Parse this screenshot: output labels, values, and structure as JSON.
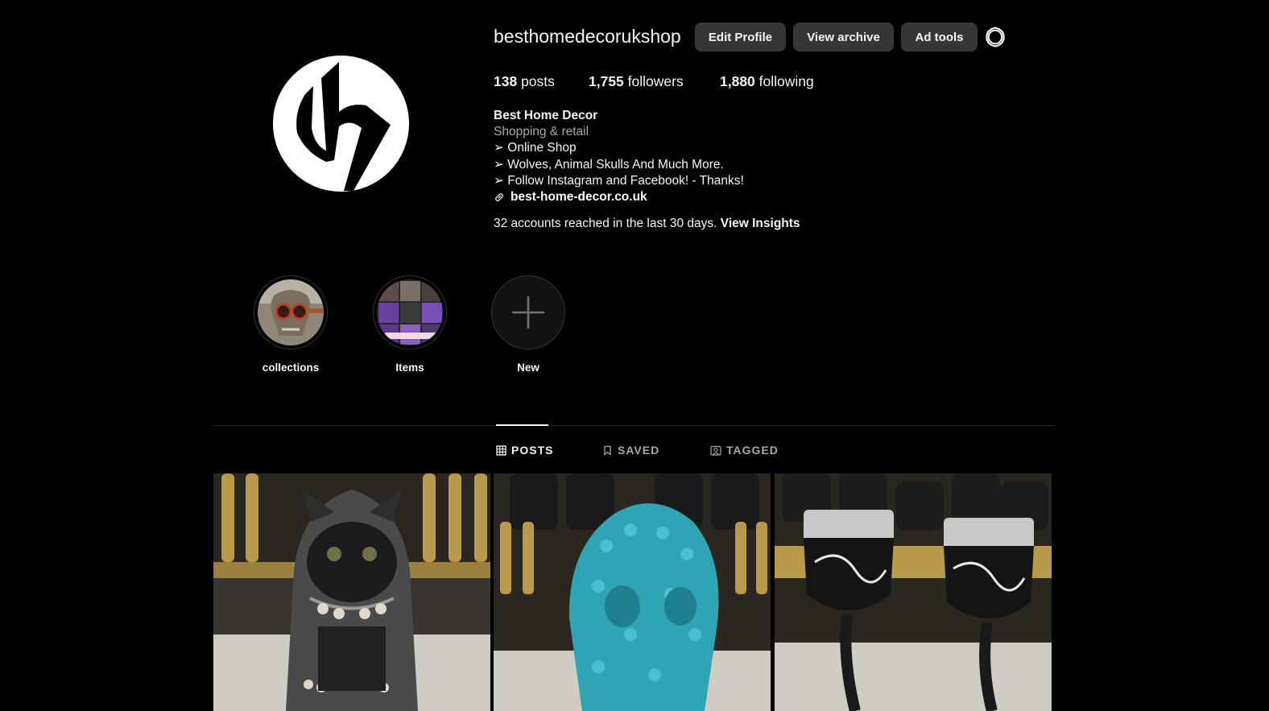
{
  "profile": {
    "username": "besthomedecorukshop",
    "buttons": {
      "edit": "Edit Profile",
      "archive": "View archive",
      "ad_tools": "Ad tools"
    },
    "stats": {
      "posts_count": "138",
      "posts_label": "posts",
      "followers_count": "1,755",
      "followers_label": "followers",
      "following_count": "1,880",
      "following_label": "following"
    },
    "bio": {
      "name": "Best Home Decor",
      "category": "Shopping & retail",
      "lines": [
        "➢ Online Shop",
        "➢ Wolves, Animal Skulls And Much More.",
        "➢ Follow Instagram and Facebook! - Thanks!"
      ],
      "link": "best-home-decor.co.uk"
    },
    "reach": {
      "text": "32 accounts reached in the last 30 days.",
      "insights": "View Insights"
    }
  },
  "highlights": [
    {
      "label": "collections"
    },
    {
      "label": "Items"
    },
    {
      "label": "New"
    }
  ],
  "tabs": [
    {
      "label": "POSTS",
      "active": true
    },
    {
      "label": "SAVED",
      "active": false
    },
    {
      "label": "TAGGED",
      "active": false
    }
  ],
  "icons": {
    "settings": "gear-icon",
    "link": "link-icon",
    "posts_tab": "grid-icon",
    "saved_tab": "bookmark-icon",
    "tagged_tab": "tag-person-icon",
    "new_highlight": "plus-icon"
  },
  "colors": {
    "background": "#000000",
    "button": "#363636",
    "text": "#f5f5f5",
    "muted": "#a8a8a8"
  }
}
